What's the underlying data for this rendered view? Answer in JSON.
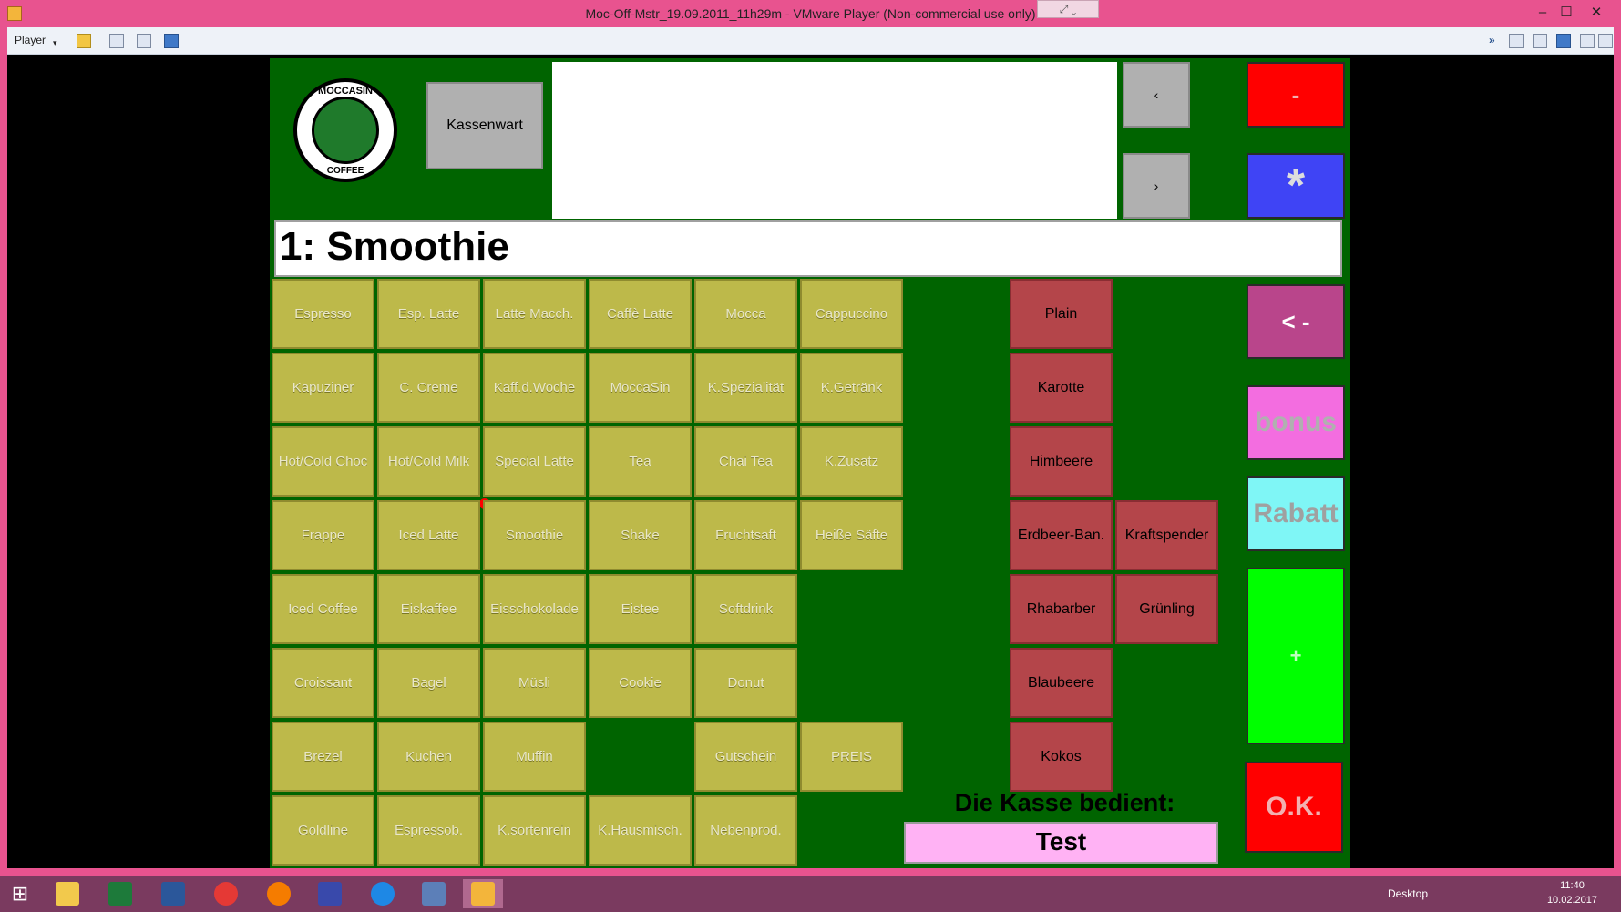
{
  "window": {
    "title": "Moc-Off-Mstr_19.09.2011_11h29m - VMware Player (Non-commercial use only)",
    "controls": {
      "minimize": "–",
      "maximize": "☐",
      "close": "✕"
    }
  },
  "toolbar": {
    "player_label": "Player"
  },
  "pos": {
    "logo": {
      "top_text": "MOCCASIN",
      "bottom_text": "COFFEE"
    },
    "operator_button": "Kassenwart",
    "nav_prev": "‹",
    "nav_next": "›",
    "current_item": "1: Smoothie",
    "side_buttons": {
      "minus": "-",
      "star": "*",
      "back": "< -",
      "bonus": "bonus",
      "rabatt": "Rabatt",
      "plus": "+",
      "ok": "O.K."
    },
    "cashier_label": "Die Kasse bedient:",
    "cashier_name": "Test",
    "products": [
      [
        "Espresso",
        "Esp. Latte",
        "Latte Macch.",
        "Caffè Latte",
        "Mocca",
        "Cappuccino"
      ],
      [
        "Kapuziner",
        "C. Creme",
        "Kaff.d.Woche",
        "MoccaSin",
        "K.Spezialität",
        "K.Getränk"
      ],
      [
        "Hot/Cold Choc",
        "Hot/Cold Milk",
        "Special Latte",
        "Tea",
        "Chai Tea",
        "K.Zusatz"
      ],
      [
        "Frappe",
        "Iced Latte",
        "Smoothie",
        "Shake",
        "Fruchtsaft",
        "Heiße Säfte"
      ],
      [
        "Iced Coffee",
        "Eiskaffee",
        "Eisschokolade",
        "Eistee",
        "Softdrink",
        ""
      ],
      [
        "Croissant",
        "Bagel",
        "Müsli",
        "Cookie",
        "Donut",
        ""
      ],
      [
        "Brezel",
        "Kuchen",
        "Muffin",
        "",
        "Gutschein",
        "PREIS"
      ],
      [
        "Goldline",
        "Espressob.",
        "K.sortenrein",
        "K.Hausmisch.",
        "Nebenprod.",
        ""
      ]
    ],
    "flavors_col1": [
      "Plain",
      "Karotte",
      "Himbeere",
      "Erdbeer-Ban.",
      "Rhabarber",
      "Blaubeere",
      "Kokos"
    ],
    "flavors_col2": [
      "Kraftspender",
      "Grünling"
    ]
  },
  "taskbar": {
    "apps": [
      "start-icon",
      "explorer-icon",
      "excel-icon",
      "word-icon",
      "chrome-icon",
      "firefox-icon",
      "save-icon",
      "ie-icon",
      "app-icon",
      "vmware-icon"
    ],
    "desktop_label": "Desktop",
    "time": "11:40",
    "date": "10.02.2017"
  }
}
